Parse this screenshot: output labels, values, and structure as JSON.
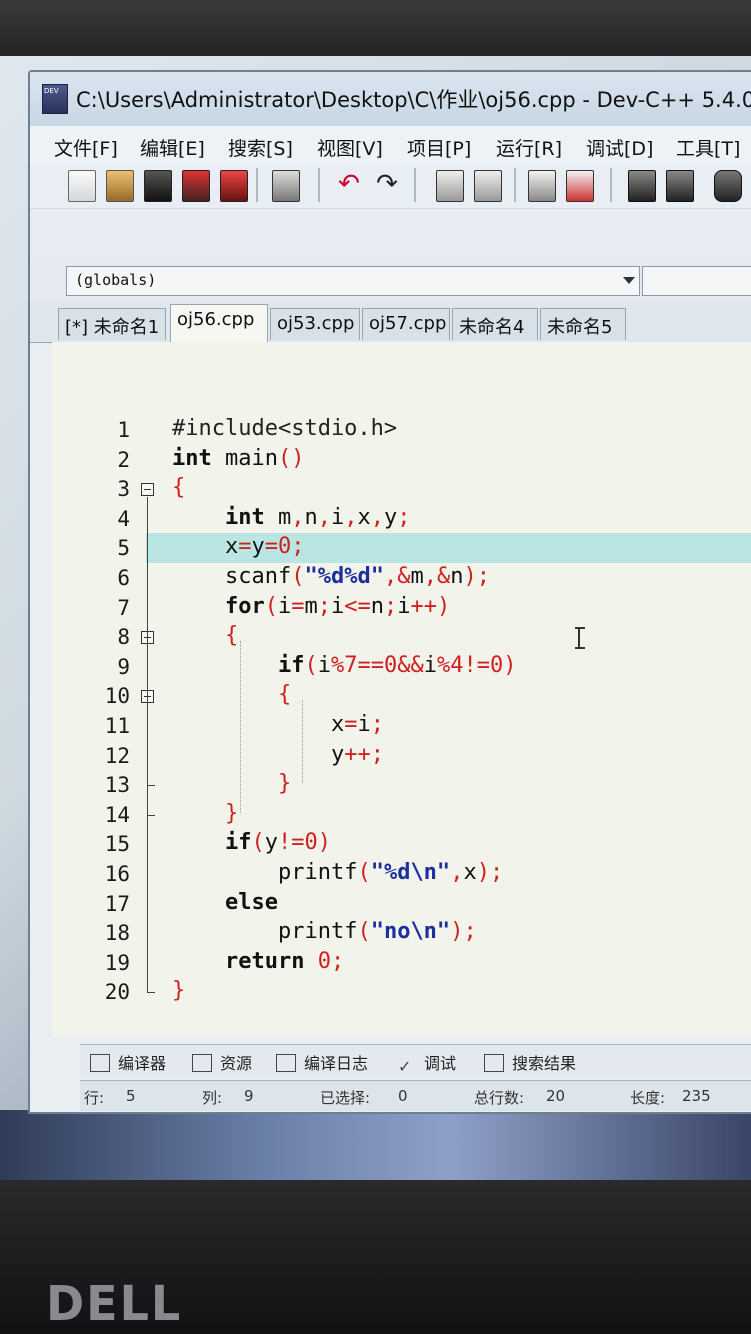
{
  "window": {
    "title": "C:\\Users\\Administrator\\Desktop\\C\\作业\\oj56.cpp - Dev-C++ 5.4.0"
  },
  "menu": [
    "文件[F]",
    "编辑[E]",
    "搜索[S]",
    "视图[V]",
    "项目[P]",
    "运行[R]",
    "调试[D]",
    "工具[T]"
  ],
  "combo": {
    "value": "(globals)"
  },
  "tabs": [
    {
      "label": "[*] 未命名1",
      "active": false
    },
    {
      "label": "oj56.cpp",
      "active": true
    },
    {
      "label": "oj53.cpp",
      "active": false
    },
    {
      "label": "oj57.cpp",
      "active": false
    },
    {
      "label": "未命名4",
      "active": false
    },
    {
      "label": "未命名5",
      "active": false
    }
  ],
  "editor": {
    "current_line": 5,
    "line_numbers": [
      "1",
      "2",
      "3",
      "4",
      "5",
      "6",
      "7",
      "8",
      "9",
      "10",
      "11",
      "12",
      "13",
      "14",
      "15",
      "16",
      "17",
      "18",
      "19",
      "20"
    ],
    "lines": [
      "#include<stdio.h>",
      "int main()",
      "{",
      "    int m,n,i,x,y;",
      "    x=y=0;",
      "    scanf(\"%d%d\",&m,&n);",
      "    for(i=m;i<=n;i++)",
      "    {",
      "        if(i%7==0&&i%4!=0)",
      "        {",
      "            x=i;",
      "            y++;",
      "        }",
      "    }",
      "    if(y!=0)",
      "        printf(\"%d\\n\",x);",
      "    else",
      "        printf(\"no\\n\");",
      "    return 0;",
      "}"
    ]
  },
  "bottom_tabs": [
    "编译器",
    "资源",
    "编译日志",
    "调试",
    "搜索结果"
  ],
  "status": {
    "row_label": "行:",
    "row_value": "5",
    "col_label": "列:",
    "col_value": "9",
    "sel_label": "已选择:",
    "sel_value": "0",
    "total_label": "总行数:",
    "total_value": "20",
    "len_label": "长度:",
    "len_value": "235"
  },
  "branding": {
    "logo": "DELL"
  }
}
